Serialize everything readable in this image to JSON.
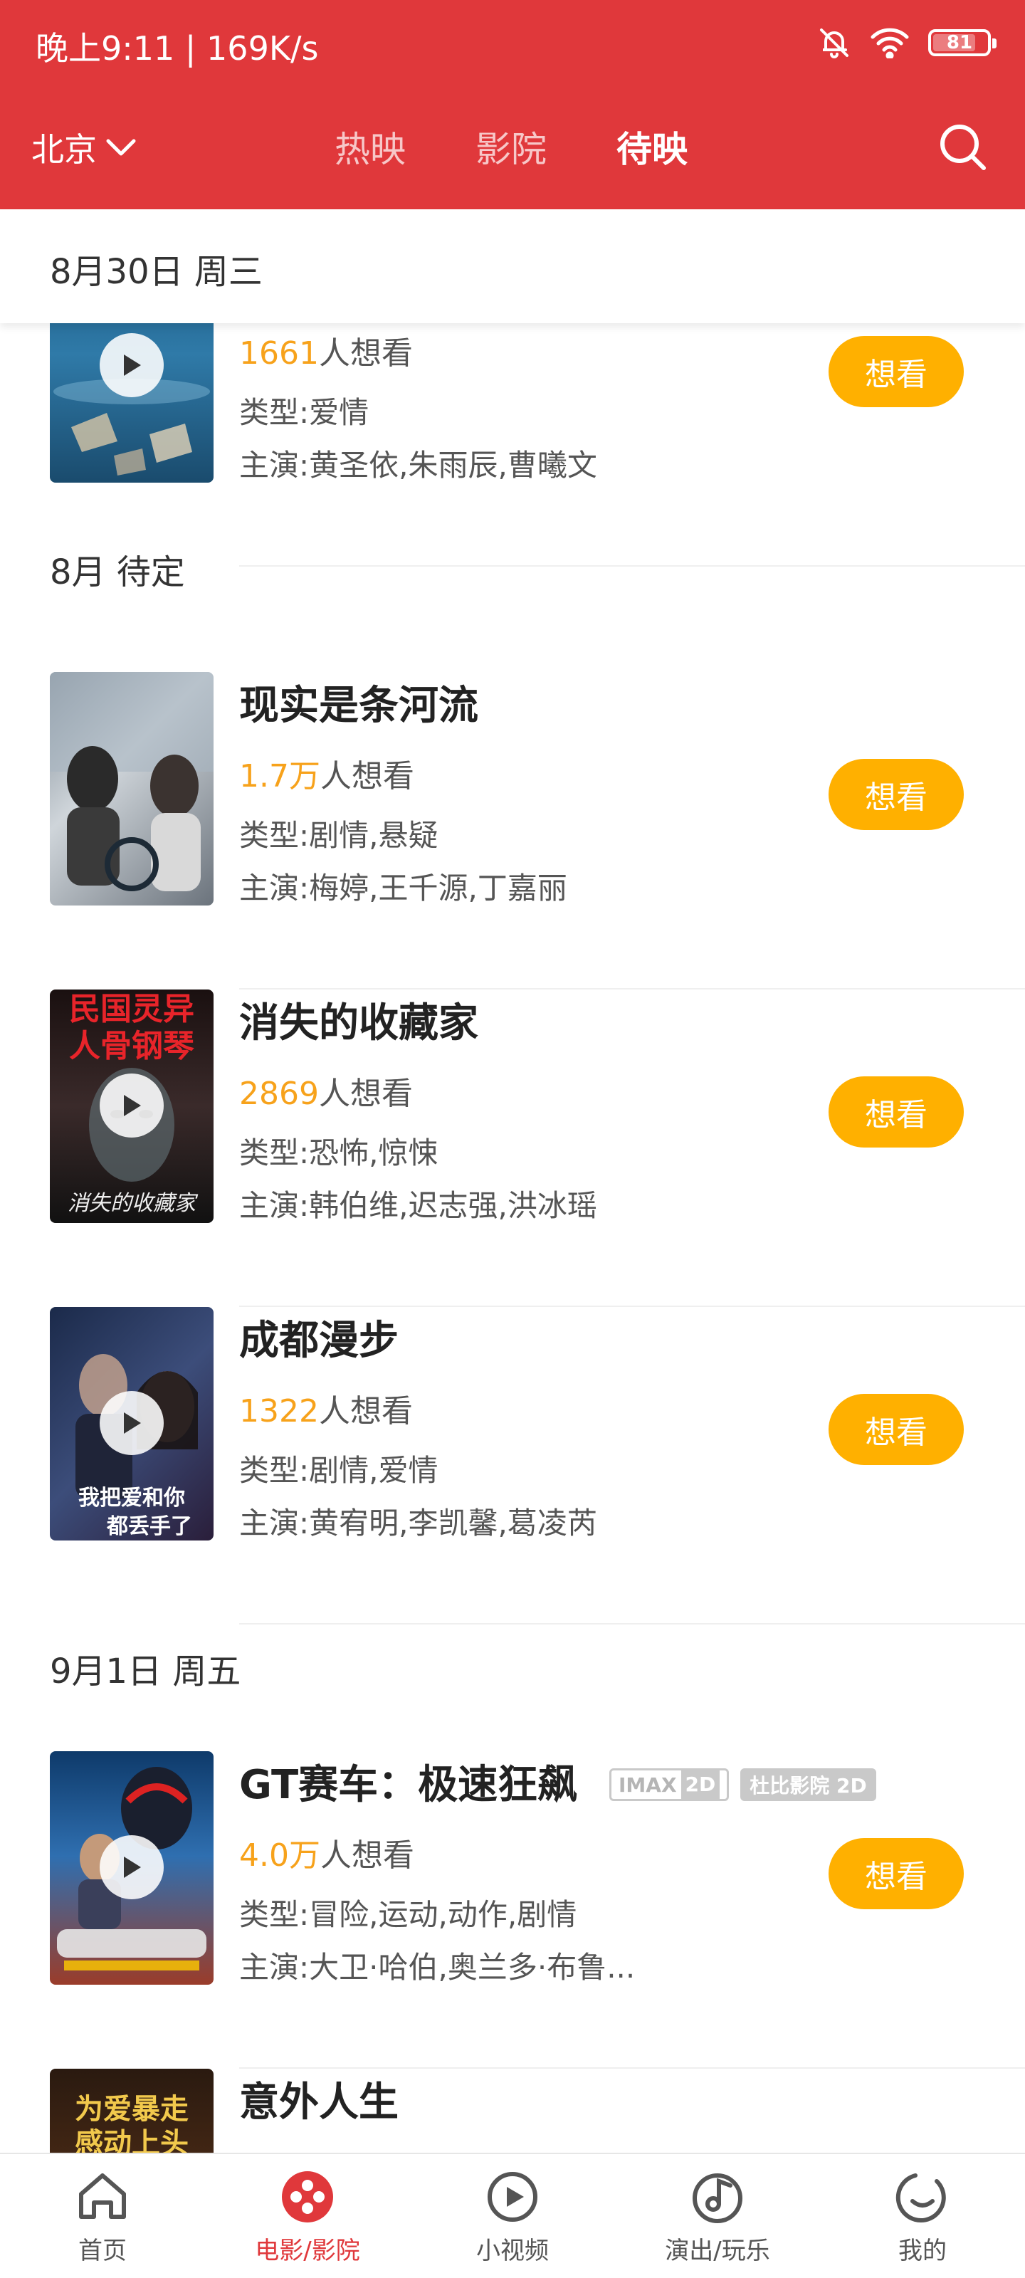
{
  "status_bar": {
    "time_speed": "晚上9:11 | 169K/s",
    "battery": "81",
    "battery_level": 0.81
  },
  "header": {
    "city": "北京",
    "tabs": [
      {
        "label": "热映",
        "active": false
      },
      {
        "label": "影院",
        "active": false
      },
      {
        "label": "待映",
        "active": true
      }
    ],
    "colors": {
      "brand": "#e0383b",
      "accent": "#f7a21b",
      "button": "#ffb000"
    }
  },
  "sticky_date": "8月30日 周三",
  "sections": [
    {
      "title": "8月 待定"
    },
    {
      "title": "9月1日 周五"
    }
  ],
  "movies": [
    {
      "title": "",
      "wants_num": "1661",
      "wants_suffix": "人想看",
      "genre": "类型:爱情",
      "cast": "主演:黄圣依,朱雨辰,曹曦文",
      "button": "想看",
      "has_play": true
    },
    {
      "title": "现实是条河流",
      "wants_num": "1.7万",
      "wants_suffix": "人想看",
      "genre": "类型:剧情,悬疑",
      "cast": "主演:梅婷,王千源,丁嘉丽",
      "button": "想看",
      "has_play": false
    },
    {
      "title": "消失的收藏家",
      "wants_num": "2869",
      "wants_suffix": "人想看",
      "genre": "类型:恐怖,惊悚",
      "cast": "主演:韩伯维,迟志强,洪冰瑶",
      "button": "想看",
      "has_play": true,
      "poster_text": [
        "民国灵异",
        "人骨钢琴",
        "消失的收藏家"
      ]
    },
    {
      "title": "成都漫步",
      "wants_num": "1322",
      "wants_suffix": "人想看",
      "genre": "类型:剧情,爱情",
      "cast": "主演:黄宥明,李凯馨,葛凌芮",
      "button": "想看",
      "has_play": true,
      "poster_text": [
        "我把爱和你",
        "都丢手了"
      ]
    },
    {
      "title": "GT赛车：极速狂飙",
      "wants_num": "4.0万",
      "wants_suffix": "人想看",
      "genre": "类型:冒险,运动,动作,剧情",
      "cast": "主演:大卫·哈伯,奥兰多·布鲁...",
      "button": "想看",
      "has_play": true,
      "badges": {
        "imax": "IMAX",
        "imax_2d": "2D",
        "dolby": "杜比影院 2D"
      }
    },
    {
      "title": "意外人生",
      "poster_text": [
        "为爱暴走",
        "感动上头"
      ]
    }
  ],
  "bottom_nav": [
    {
      "label": "首页",
      "icon": "home-icon",
      "active": false
    },
    {
      "label": "电影/影院",
      "icon": "film-reel-icon",
      "active": true
    },
    {
      "label": "小视频",
      "icon": "play-circle-icon",
      "active": false
    },
    {
      "label": "演出/玩乐",
      "icon": "music-note-icon",
      "active": false
    },
    {
      "label": "我的",
      "icon": "profile-icon",
      "active": false
    }
  ]
}
